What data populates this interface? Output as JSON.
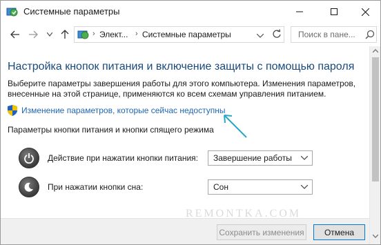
{
  "window": {
    "title": "Системные параметры",
    "accent": "#0078d7"
  },
  "address_bar": {
    "crumbs": [
      "Элект...",
      "Системные параметры"
    ],
    "separator": "›"
  },
  "search": {
    "placeholder": "Поиск в пане..."
  },
  "content": {
    "heading": "Настройка кнопок питания и включение защиты с помощью пароля",
    "description": "Выберите параметры завершения работы для этого компьютера. Изменения параметров, внесенные на этой странице, применяются ко всем схемам управления питанием.",
    "link": "Изменение параметров, которые сейчас недоступны",
    "section_title": "Параметры кнопки питания и кнопки спящего режима",
    "options": [
      {
        "label": "Действие при нажатии кнопки питания:",
        "value": "Завершение работы",
        "icon": "power-icon"
      },
      {
        "label": "При нажатии кнопки сна:",
        "value": "Сон",
        "icon": "sleep-icon"
      }
    ]
  },
  "footer": {
    "save_label": "Сохранить изменения",
    "cancel_label": "Отмена"
  },
  "watermark": "REMONTKA.COM",
  "colors": {
    "heading": "#18497c",
    "link": "#1f66b3",
    "annotation_arrow": "#2aa7c9"
  }
}
